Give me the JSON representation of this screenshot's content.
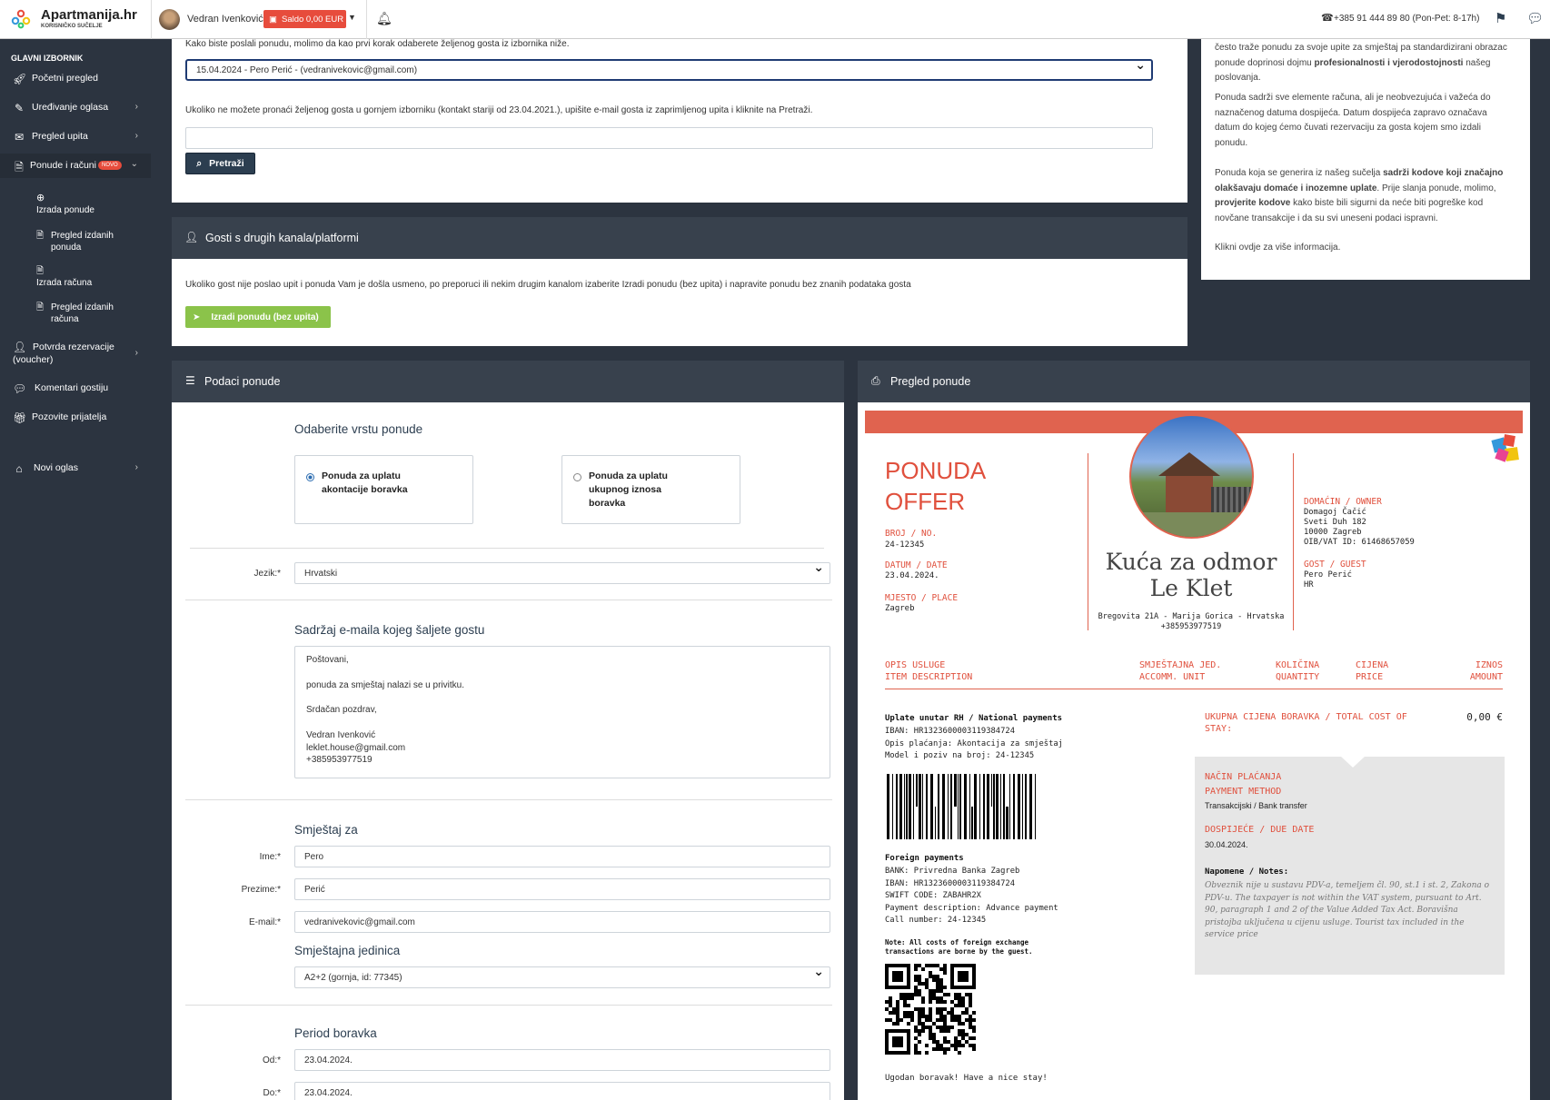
{
  "brand": {
    "title": "Apartmanija.hr",
    "subtitle": "KORISNIČKO SUČELJE"
  },
  "user": {
    "name": "Vedran Ivenković",
    "saldo": "Saldo 0,00 EUR"
  },
  "contact": {
    "phone": "+385 91 444 89 80 (Pon-Pet: 8-17h)"
  },
  "sidebar": {
    "heading": "GLAVNI IZBORNIK",
    "items": [
      {
        "label": "Početni pregled",
        "icon": "rocket-icon"
      },
      {
        "label": "Uređivanje oglasa",
        "icon": "pencil-icon"
      },
      {
        "label": "Pregled upita",
        "icon": "envelope-icon"
      },
      {
        "label": "Ponude i računi",
        "icon": "file-icon",
        "badge": "NOVO"
      },
      {
        "label": "Izrada ponude",
        "icon": "plus-circle-icon"
      },
      {
        "label": "Pregled izdanih ponuda",
        "icon": "file-icon"
      },
      {
        "label": "Izrada računa",
        "icon": "file-icon"
      },
      {
        "label": "Pregled izdanih računa",
        "icon": "file-icon"
      },
      {
        "label": "Potvrda rezervacije (voucher)",
        "icon": "user-icon"
      },
      {
        "label": "Komentari gostiju",
        "icon": "comments-icon"
      },
      {
        "label": "Pozovite prijatelja",
        "icon": "gift-icon"
      },
      {
        "label": "Novi oglas",
        "icon": "home-icon"
      }
    ]
  },
  "guest_section": {
    "intro": "Kako biste poslali ponudu, molimo da kao prvi korak odaberete željenog gosta iz izbornika niže.",
    "guest_select": "15.04.2024 - Pero Perić - (vedranivekovic@gmail.com)",
    "hint": "Ukoliko ne možete pronaći željenog gosta u gornjem izborniku (kontakt stariji od 23.04.2021.), upišite e-mail gosta iz zaprimljenog upita i kliknite na Pretraži.",
    "search_value": "",
    "search_button": "Pretraži"
  },
  "other_channels": {
    "title": "Gosti s drugih kanala/platformi",
    "text": "Ukoliko gost nije poslao upit i ponuda Vam je došla usmeno, po preporuci ili nekim drugim kanalom izaberite Izradi ponudu (bez upita) i napravite ponudu bez znanih podataka gosta",
    "button": "Izradi ponudu (bez upita)"
  },
  "info_box": {
    "p1a": "često traže ponudu za svoje upite za smještaj pa standardizirani obrazac ponude doprinosi dojmu ",
    "p1b": "profesionalnosti i vjerodostojnosti",
    "p1c": " našeg poslovanja.",
    "p2": "Ponuda sadrži sve elemente računa, ali je neobvezujuća i važeća do naznačenog datuma dospijeća. Datum dospijeća zapravo označava datum do kojeg ćemo čuvati rezervaciju za gosta kojem smo izdali ponudu.",
    "p3a": "Ponuda koja se generira iz našeg sučelja ",
    "p3b": "sadrži kodove koji značajno olakšavaju domaće i inozemne uplate",
    "p3c": ". Prije slanja ponude, molimo, ",
    "p3d": "provjerite kodove",
    "p3e": " kako biste bili sigurni da neće biti pogreške kod novčane transakcije i da su svi uneseni podaci ispravni.",
    "p4": "Klikni ovdje za više informacija."
  },
  "form": {
    "panel_title": "Podaci ponude",
    "type_heading": "Odaberite vrstu ponude",
    "option1": "Ponuda za uplatu akontacije boravka",
    "option2": "Ponuda za uplatu ukupnog iznosa boravka",
    "lang_label": "Jezik:*",
    "lang_value": "Hrvatski",
    "email_heading": "Sadržaj e-maila kojeg šaljete gostu",
    "email_lines": [
      "Poštovani,",
      "",
      "ponuda za smještaj nalazi se u privitku.",
      "",
      "Srdačan pozdrav,",
      "",
      "Vedran Ivenković",
      "leklet.house@gmail.com",
      "+385953977519"
    ],
    "stay_heading": "Smještaj za",
    "ime_label": "Ime:*",
    "ime": "Pero",
    "prezime_label": "Prezime:*",
    "prezime": "Perić",
    "email_label": "E-mail:*",
    "email": "vedranivekovic@gmail.com",
    "unit_heading": "Smještajna jedinica",
    "unit": "A2+2 (gornja, id: 77345)",
    "period_heading": "Period boravka",
    "od_label": "Od:*",
    "od": "23.04.2024.",
    "do_label": "Do:*",
    "do": "23.04.2024."
  },
  "preview": {
    "panel_title": "Pregled ponude",
    "offer_hr": "PONUDA",
    "offer_en": "OFFER",
    "no_label": "BROJ / NO.",
    "no": "24-12345",
    "date_label": "DATUM / DATE",
    "date": "23.04.2024.",
    "place_label": "MJESTO / PLACE",
    "place": "Zagreb",
    "property_name": "Kuća za odmor Le Klet",
    "property_address": "Bregovita 21A - Marija Gorica - Hrvatska",
    "property_phone": "+385953977519",
    "owner_label": "DOMAĆIN / OWNER",
    "owner_lines": [
      "Domagoj Čačić",
      "Sveti Duh 182",
      "10000 Zagreb",
      "OIB/VAT ID: 61468657059"
    ],
    "guest_label": "GOST / GUEST",
    "guest_lines": [
      "Pero Perić",
      "HR"
    ],
    "col_desc": [
      "OPIS USLUGE",
      "ITEM DESCRIPTION"
    ],
    "col_unit": [
      "SMJEŠTAJNA JED.",
      "ACCOMM. UNIT"
    ],
    "col_qty": [
      "KOLIČINA",
      "QUANTITY"
    ],
    "col_price": [
      "CIJENA",
      "PRICE"
    ],
    "col_amount": [
      "IZNOS",
      "AMOUNT"
    ],
    "nat_title": "Uplate unutar RH / National payments",
    "nat_lines": [
      "IBAN: HR1323600003119384724",
      "Opis plaćanja: Akontacija za smještaj",
      "Model i poziv na broj: 24-12345"
    ],
    "for_title": "Foreign payments",
    "for_lines": [
      "BANK: Privredna Banka Zagreb",
      "IBAN: HR1323600003119384724",
      "SWIFT CODE: ZABAHR2X",
      "Payment description: Advance payment",
      "Call number: 24-12345"
    ],
    "fx_note": "Note: All costs of foreign exchange transactions are borne by the guest.",
    "goodbye": "Ugodan boravak! Have a nice stay!",
    "total_label": "UKUPNA CIJENA BORAVKA / TOTAL COST OF STAY:",
    "total_value": "0,00 €",
    "method_label": [
      "NAČIN PLAĆANJA",
      "PAYMENT METHOD"
    ],
    "method_value": "Transakcijski / Bank transfer",
    "due_label": "DOSPIJEĆE / DUE DATE",
    "due_value": "30.04.2024.",
    "notes_label": "Napomene / Notes:",
    "notes": "Obveznik nije u sustavu PDV-a, temeljem čl. 90, st.1 i st. 2, Zakona o PDV-u. The taxpayer is not within the VAT system, pursuant to Art. 90, paragraph 1 and 2 of the Value Added Tax Act. Boravišna pristojba uključena u cijenu usluge. Tourist tax included in the service price"
  },
  "colors": {
    "accent": "#e0503d",
    "sidebar": "#2c3440",
    "panel_header": "#38414d",
    "green": "#8bc34a",
    "navy": "#2c3e50"
  }
}
